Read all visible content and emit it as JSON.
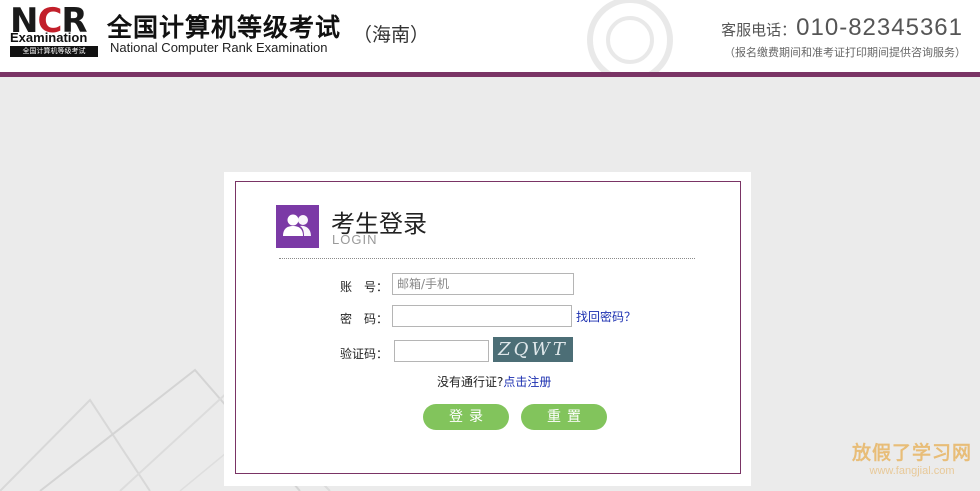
{
  "header": {
    "logo": {
      "letters_left": "N",
      "letters_mid": "C",
      "letters_right": "R",
      "exam_word": "Examination",
      "band_text": "全国计算机等级考试"
    },
    "title_cn": "全国计算机等级考试",
    "title_en": "National Computer Rank Examination",
    "region": "（海南）",
    "hotline_label": "客服电话：",
    "hotline_number": "010-82345361",
    "hotline_note": "（报名缴费期间和准考证打印期间提供咨询服务）"
  },
  "login": {
    "title": "考生登录",
    "subtitle": "LOGIN",
    "account_label": "账　号：",
    "account_placeholder": "邮箱/手机",
    "password_label": "密　码：",
    "forgot_link": "找回密码？",
    "captcha_label": "验证码：",
    "captcha_text": "ZQWT",
    "register_prompt": "没有通行证?",
    "register_link": "点击注册",
    "login_button": "登录",
    "reset_button": "重置"
  },
  "watermark": {
    "cn": "放假了学习网",
    "url": "www.fangjial.com"
  },
  "colors": {
    "brand_purple": "#7a3465",
    "icon_purple": "#7b3aa6",
    "button_green": "#82c45c",
    "link_blue": "#1b2fb0"
  },
  "icons": {
    "login_icon": "users-icon"
  }
}
